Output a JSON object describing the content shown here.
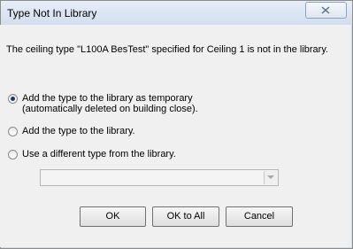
{
  "window": {
    "title": "Type Not In Library"
  },
  "message": "The ceiling type \"L100A BesTest\" specified for Ceiling 1 is not in the library.",
  "options": [
    {
      "line1": "Add the type to the library as temporary",
      "line2": "(automatically deleted on building close).",
      "selected": true
    },
    {
      "line1": "Add the type to the library.",
      "selected": false
    },
    {
      "line1": "Use a different type from the library.",
      "selected": false
    }
  ],
  "library_select": {
    "value": ""
  },
  "buttons": {
    "ok": "OK",
    "ok_all": "OK to All",
    "cancel": "Cancel"
  },
  "colors": {
    "title_bar": "#d1deee",
    "client_bg": "#f0f0f0",
    "radio_dot": "#1d3a6b"
  }
}
